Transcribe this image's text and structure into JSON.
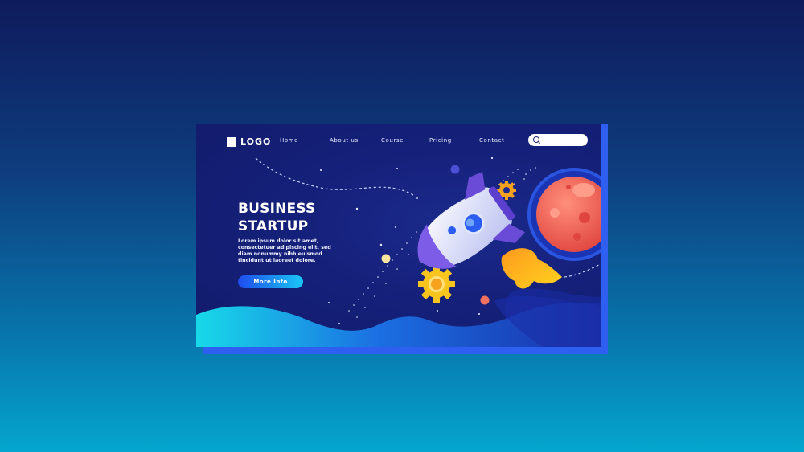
{
  "brand": {
    "logo_text": "LOGO"
  },
  "nav": {
    "items": [
      {
        "label": "Home"
      },
      {
        "label": "About us"
      },
      {
        "label": "Course"
      },
      {
        "label": "Pricing"
      },
      {
        "label": "Contact"
      }
    ],
    "search": {
      "placeholder": ""
    }
  },
  "hero": {
    "title_line1": "BUSINESS",
    "title_line2": "STARTUP",
    "body_lines": [
      "Lorem ipsum dolor sit amet,",
      "consectetuer adipiscing elit, sed",
      "diam nonummy nibh euismod",
      "tincidunt ut laoreet dolore."
    ],
    "cta_label": "More Info"
  },
  "colors": {
    "background_top": "#0f1b5c",
    "background_bottom": "#05a6cf",
    "frame": "#15207a",
    "accent_button": "#1f4cf0",
    "planet": "#f26a5e",
    "gear": "#f7c51e"
  },
  "icons": [
    "logo-square-icon",
    "search-icon",
    "rocket-icon",
    "planet-icon",
    "gear-icon"
  ]
}
